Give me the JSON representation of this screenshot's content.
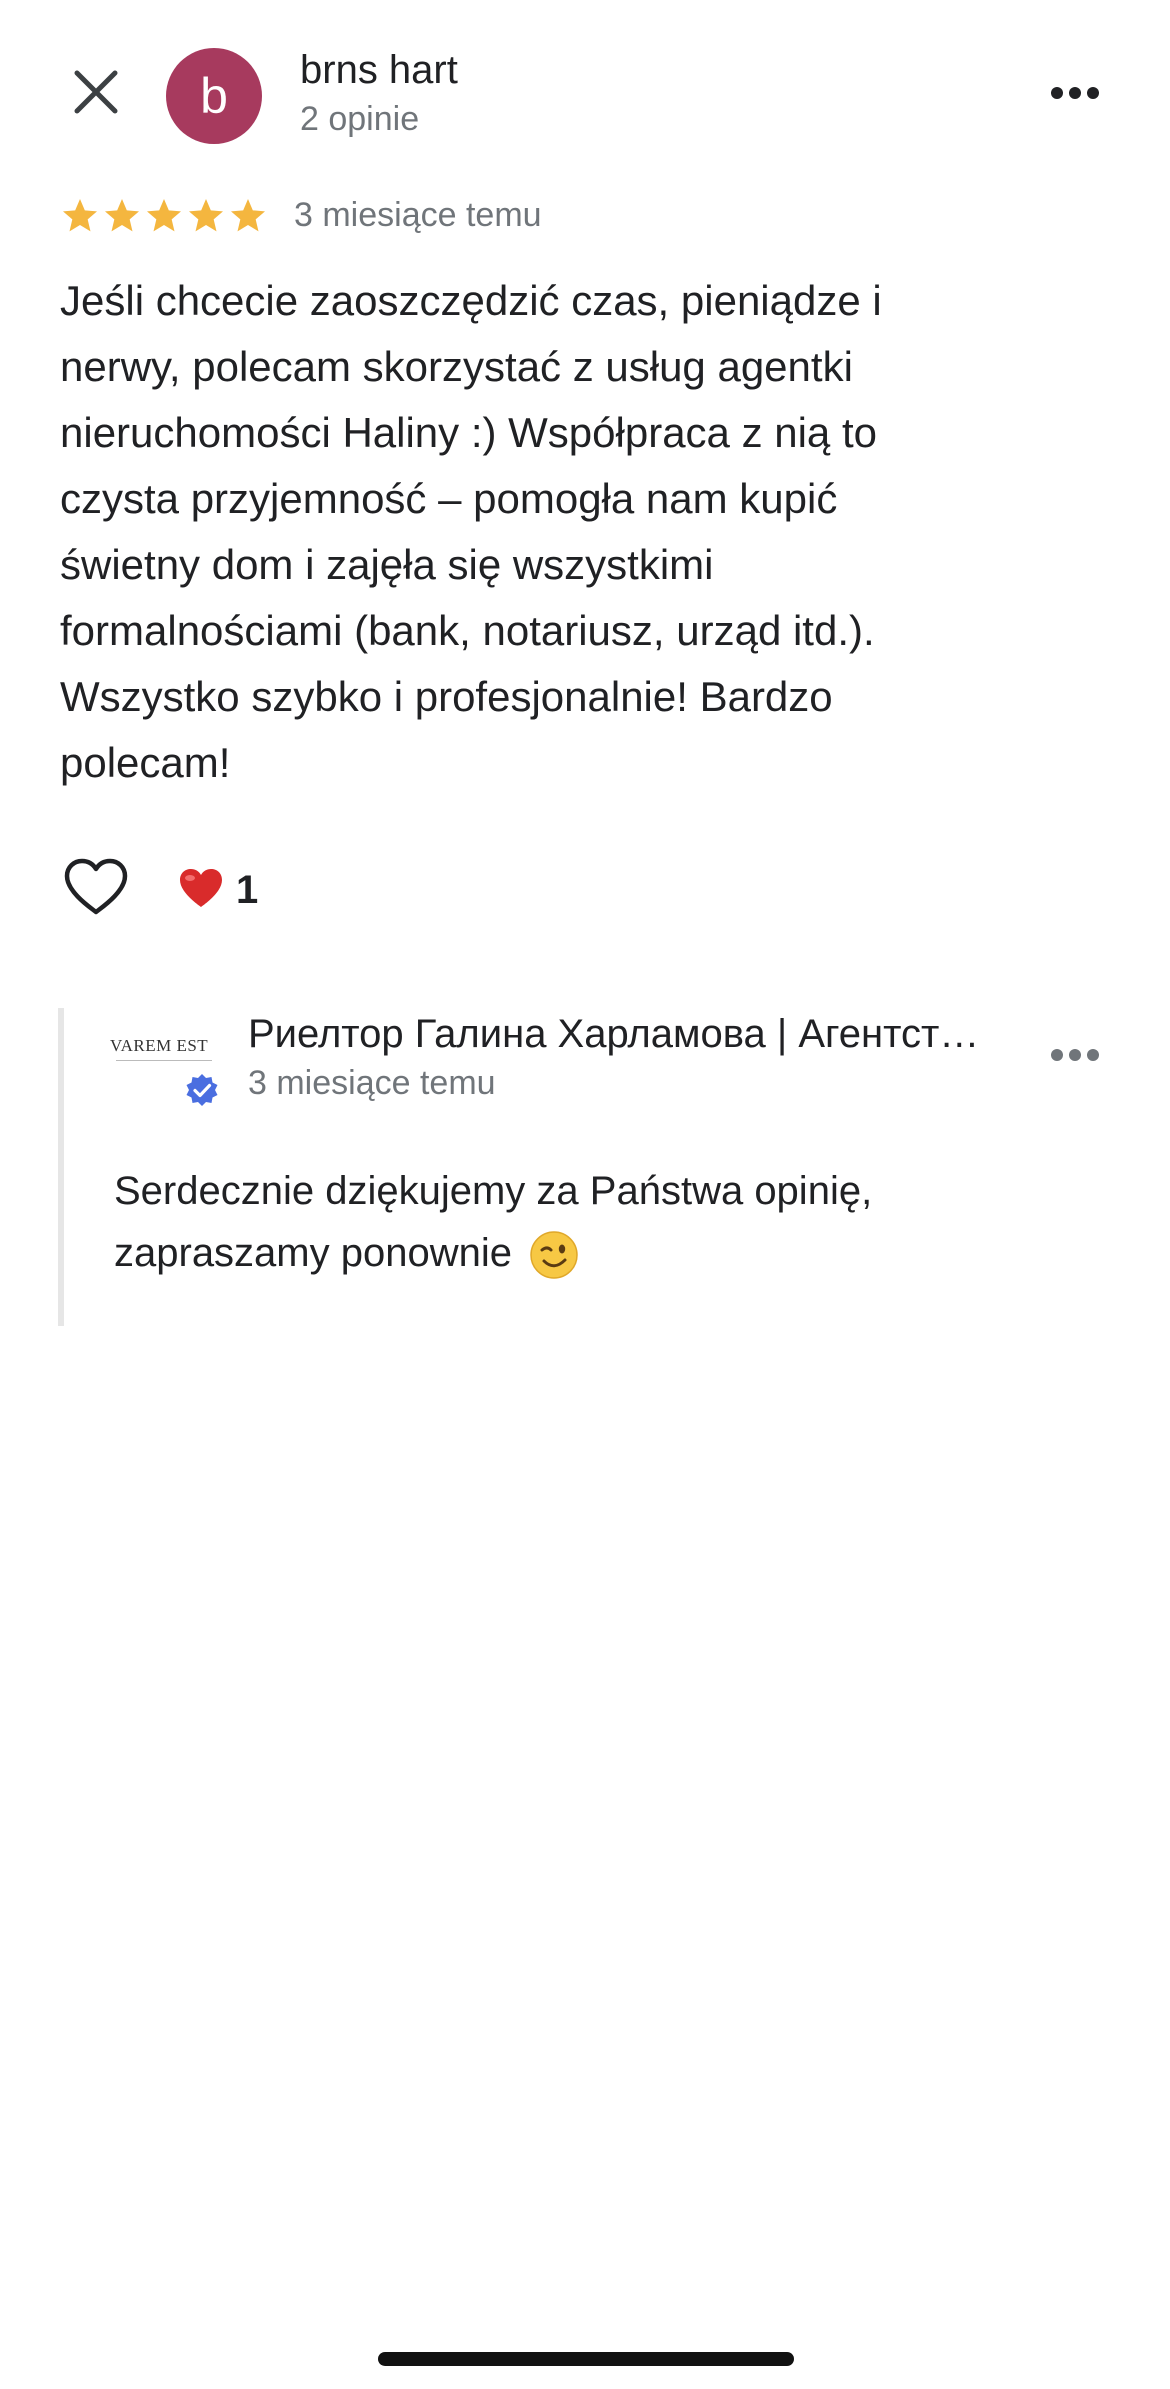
{
  "header": {
    "avatar_letter": "b",
    "avatar_color": "#a73a5e",
    "author_name": "brns hart",
    "author_meta": "2 opinie",
    "close_icon": "close-icon",
    "more_icon": "more-horizontal-icon"
  },
  "review": {
    "rating": 5,
    "rating_max": 5,
    "star_color": "#f4b63f",
    "date": "3 miesiące temu",
    "text_lines": [
      "Jeśli chcecie zaoszczędzić czas, pieniądze i",
      "nerwy, polecam skorzystać z usług agentki",
      "nieruchomości Haliny :) Współpraca z nią to",
      "czysta przyjemność – pomogła nam kupić",
      "świetny dom i zajęła się wszystkimi",
      "formalnościami (bank, notariusz, urząd itd.).",
      "Wszystko szybko i profesjonalnie! Bardzo",
      "polecam!"
    ]
  },
  "reactions": {
    "like_icon": "heart-outline-icon",
    "reaction_icon": "red-heart-icon",
    "count": "1"
  },
  "owner_response": {
    "logo_text": "VAREM EST",
    "verified_icon": "verified-badge-icon",
    "verified_color": "#4a6ee0",
    "name": "Риелтор Галина Харламова | Агентство недвижимости",
    "date": "3 miesiące temu",
    "text_line1": "Serdecznie dziękujemy za Państwa opinię,",
    "text_line2": "zapraszamy ponownie",
    "emoji_icon": "winking-face-icon"
  }
}
